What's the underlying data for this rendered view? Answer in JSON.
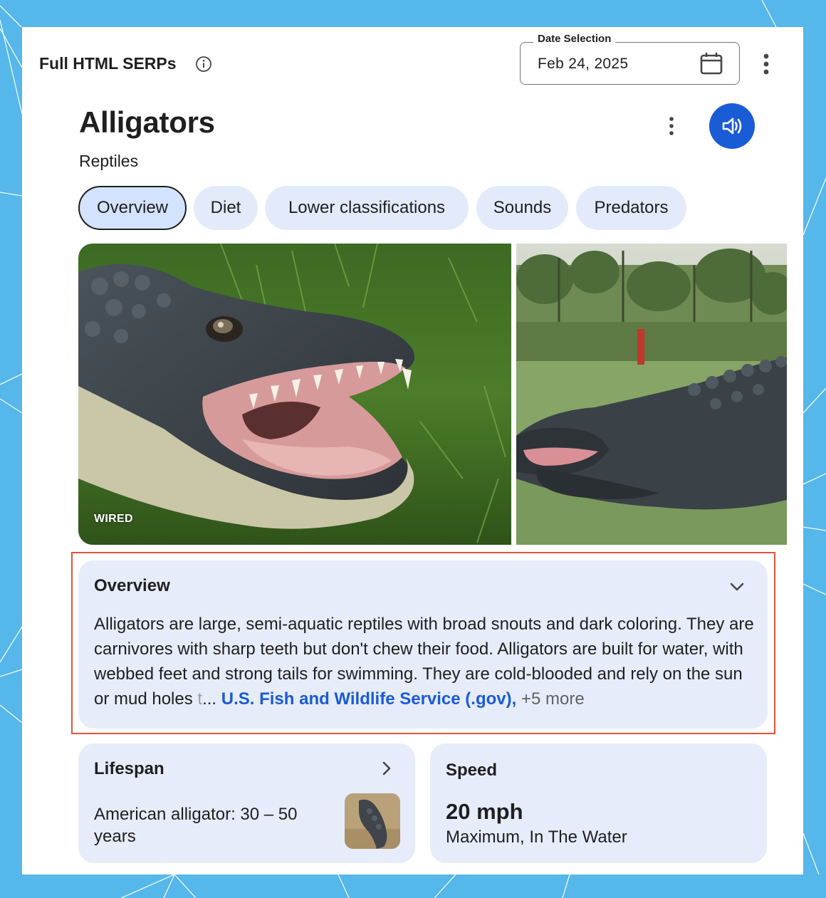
{
  "app": {
    "title": "Full HTML SERPs",
    "date_label": "Date Selection",
    "date_value": "Feb 24, 2025"
  },
  "panel": {
    "title": "Alligators",
    "subtitle": "Reptiles",
    "tabs": [
      {
        "label": "Overview",
        "active": true
      },
      {
        "label": "Diet",
        "active": false
      },
      {
        "label": "Lower classifications",
        "active": false
      },
      {
        "label": "Sounds",
        "active": false
      },
      {
        "label": "Predators",
        "active": false
      }
    ],
    "images": [
      {
        "credit": "WIRED"
      }
    ]
  },
  "overview": {
    "heading": "Overview",
    "text": "Alligators are large, semi-aquatic reptiles with broad snouts and dark coloring. They are carnivores with sharp teeth but don't chew their food. Alligators are built for water, with webbed feet and strong tails for swimming. They are cold-blooded and rely on the sun or mud holes ",
    "faded": "t",
    "ellipsis": "... ",
    "source": "U.S. Fish and Wildlife Service (.gov),",
    "more": " +5 more"
  },
  "facts": {
    "lifespan": {
      "heading": "Lifespan",
      "text": "American alligator: 30 – 50 years"
    },
    "speed": {
      "heading": "Speed",
      "value": "20 mph",
      "detail": "Maximum, In The Water"
    }
  },
  "colors": {
    "accent": "#1a5bd6",
    "card_bg": "#e6ecfa",
    "chip_bg": "#e3ebfb",
    "highlight": "#e0533a",
    "frame": "#55b7ea"
  },
  "icons": [
    "info-icon",
    "calendar-icon",
    "more-vert-icon",
    "speaker-icon",
    "chevron-down-icon",
    "chevron-right-icon"
  ]
}
